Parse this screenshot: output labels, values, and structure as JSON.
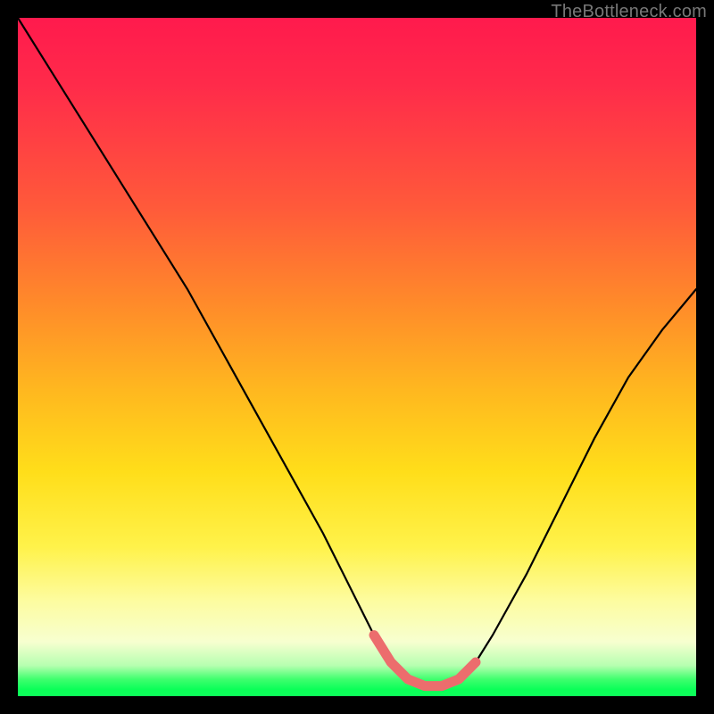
{
  "watermark": "TheBottleneck.com",
  "colors": {
    "frame": "#000000",
    "curve": "#000000",
    "highlight": "#ec6d6d"
  },
  "chart_data": {
    "type": "line",
    "title": "",
    "xlabel": "",
    "ylabel": "",
    "xlim": [
      0,
      100
    ],
    "ylim": [
      0,
      100
    ],
    "grid": false,
    "legend": false,
    "series": [
      {
        "name": "bottleneck-curve",
        "x": [
          0,
          5,
          10,
          15,
          20,
          25,
          30,
          35,
          40,
          45,
          50,
          52.5,
          55,
          57.5,
          60,
          62.5,
          65,
          67.5,
          70,
          75,
          80,
          85,
          90,
          95,
          100
        ],
        "values": [
          100,
          92,
          84,
          76,
          68,
          60,
          51,
          42,
          33,
          24,
          14,
          9,
          5,
          2.5,
          1.5,
          1.5,
          2.5,
          5,
          9,
          18,
          28,
          38,
          47,
          54,
          60
        ]
      }
    ],
    "highlight_range": {
      "x_start": 52.5,
      "x_end": 67.5
    }
  }
}
